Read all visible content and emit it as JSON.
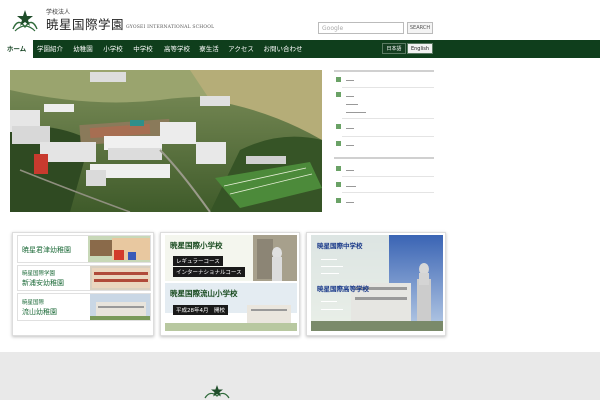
{
  "header": {
    "org_type": "学校法人",
    "school_name": "暁星国際学園",
    "school_name_en": "GYOSEI INTERNATIONAL SCHOOL",
    "search_placeholder": "Google",
    "search_button": "SEARCH"
  },
  "nav": {
    "items": [
      {
        "label": "ホーム"
      },
      {
        "label": "学園紹介"
      },
      {
        "label": "幼稚園"
      },
      {
        "label": "小学校"
      },
      {
        "label": "中学校"
      },
      {
        "label": "高等学校"
      },
      {
        "label": "寮生活"
      },
      {
        "label": "アクセス"
      },
      {
        "label": "お問い合わせ"
      }
    ],
    "lang_jp": "日本語",
    "lang_en": "English"
  },
  "cards": {
    "kinder": {
      "k1": "暁星君津幼稚園",
      "k2_line1": "暁星国際学園",
      "k2_line2": "新浦安幼稚園",
      "k3_line1": "暁星国際",
      "k3_line2": "流山幼稚園"
    },
    "elem": {
      "title1": "暁星国際小学校",
      "sub1_a": "レギュラーコース",
      "sub1_b": "インターナショナルコース",
      "title2": "暁星国際流山小学校",
      "sub2": "平成28年4月　開校"
    },
    "high": {
      "title1": "暁星国際中学校",
      "title2": "暁星国際高等学校"
    }
  },
  "colors": {
    "nav_green": "#0f3e1c",
    "accent_green": "#6aa266",
    "school_blue": "#1a3a8a"
  }
}
